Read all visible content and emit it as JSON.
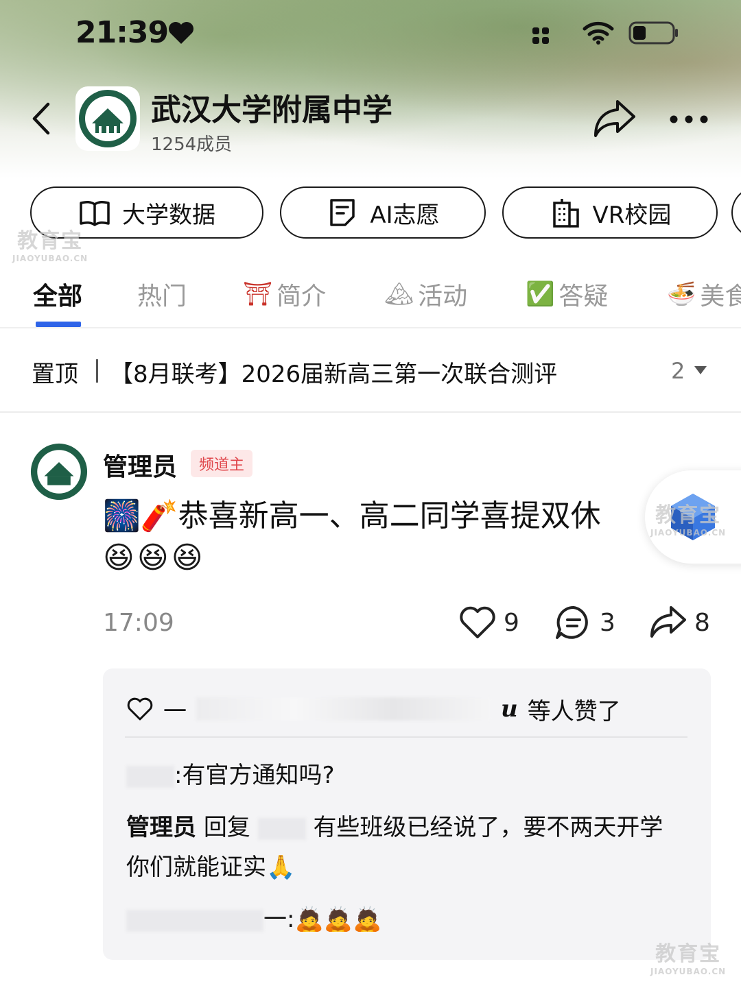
{
  "status_bar": {
    "time": "21:39"
  },
  "header": {
    "group_name": "武汉大学附属中学",
    "member_count": "1254成员"
  },
  "quick_buttons": [
    {
      "label": "大学数据",
      "icon": "book-icon"
    },
    {
      "label": "AI志愿",
      "icon": "note-icon"
    },
    {
      "label": "VR校园",
      "icon": "building-icon"
    }
  ],
  "tabs": [
    {
      "label": "全部",
      "active": true
    },
    {
      "label": "热门"
    },
    {
      "label": "简介",
      "emoji": "⛩"
    },
    {
      "label": "活动",
      "emoji": "🏔"
    },
    {
      "label": "答疑",
      "emoji": "✅"
    },
    {
      "label": "美食",
      "emoji": "🍜"
    }
  ],
  "pinned": {
    "label": "置顶",
    "title": "【8月联考】2026届新高三第一次联合测评",
    "count": "2"
  },
  "post": {
    "author": "管理员",
    "badge": "频道主",
    "text": "🎆🧨恭喜新高一、高二同学喜提双休",
    "emojis": "😆😆😆",
    "time": "17:09",
    "likes": "9",
    "comments": "3",
    "shares": "8"
  },
  "likes_summary": {
    "prefix": "一",
    "suffix_name": "u",
    "suffix": "等人赞了"
  },
  "comments": [
    {
      "text": ":有官方通知吗?"
    },
    {
      "author": "管理员",
      "reply_word": "回复",
      "text": "有些班级已经说了，要不两天开学你们就能证实🙏"
    },
    {
      "prefix": "一",
      "text": ":🙇🙇🙇"
    }
  ],
  "watermarks": {
    "main": "教育宝",
    "sub": "JIAOYUBAO.CN"
  },
  "colors": {
    "accent": "#2e64e8",
    "badge_bg": "#fde8e8",
    "badge_text": "#e0474c",
    "comment_bg": "#f4f4f6"
  }
}
